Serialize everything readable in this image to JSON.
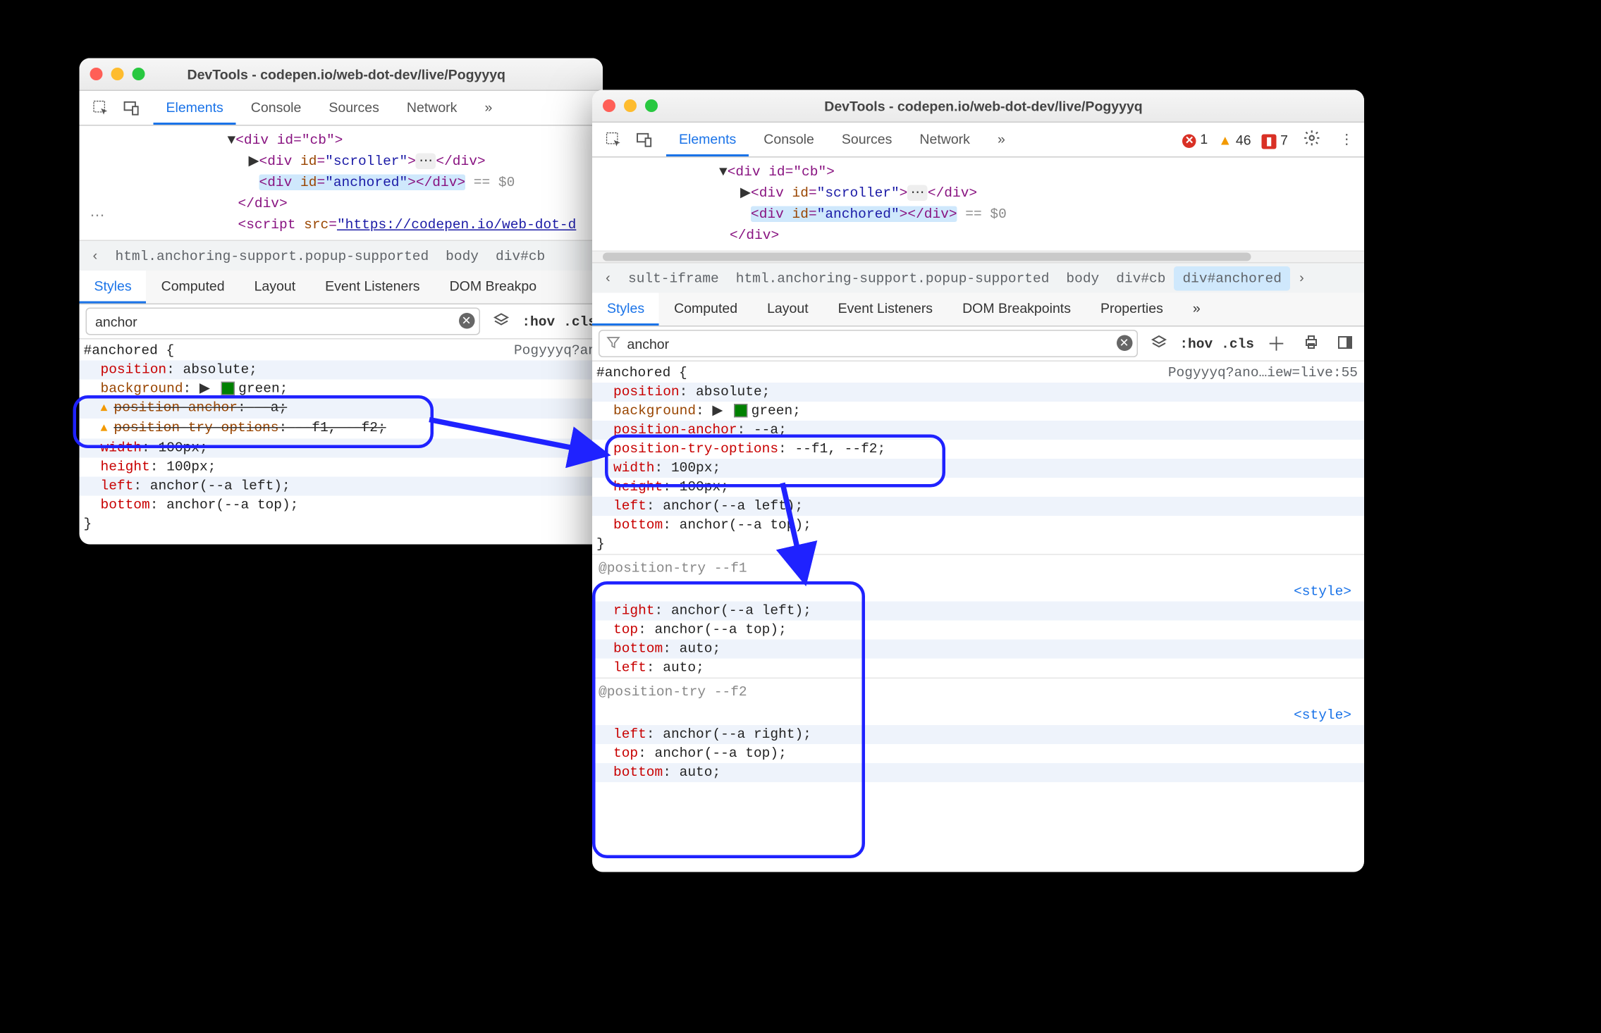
{
  "left": {
    "title": "DevTools - codepen.io/web-dot-dev/live/Pogyyyq",
    "tabs": [
      "Elements",
      "Console",
      "Sources",
      "Network"
    ],
    "activeTab": "Elements",
    "more": "»",
    "dom": {
      "l1": "<div id=\"cb\">",
      "l2_open": "<div id=\"scroller\">",
      "l2_close": "</div>",
      "l3": "<div id=\"anchored\"></div>",
      "eq": " == $0",
      "l4": "</div>",
      "script_open": "<script src=",
      "script_url": "\"https://codepen.io/web-dot-d"
    },
    "breadcrumbs": [
      "html.anchoring-support.popup-supported",
      "body",
      "div#cb"
    ],
    "subtabs": [
      "Styles",
      "Computed",
      "Layout",
      "Event Listeners",
      "DOM Breakpo"
    ],
    "activeSub": "Styles",
    "filter": "anchor",
    "hov": ":hov",
    "cls": ".cls",
    "cssLink": "Pogyyyq?an",
    "css": {
      "selector": "#anchored {",
      "p1": "position",
      "v1": "absolute",
      "p2": "background",
      "v2": "green",
      "p3": "position-anchor",
      "v3": "--a",
      "p4": "position-try-options",
      "v4": "--f1, --f2",
      "p5": "width",
      "v5": "100px",
      "p6": "height",
      "v6": "100px",
      "p7": "left",
      "v7": "anchor(--a left)",
      "p8": "bottom",
      "v8": "anchor(--a top)"
    }
  },
  "right": {
    "title": "DevTools - codepen.io/web-dot-dev/live/Pogyyyq",
    "tabs": [
      "Elements",
      "Console",
      "Sources",
      "Network"
    ],
    "activeTab": "Elements",
    "more": "»",
    "errors": "1",
    "warnings": "46",
    "blocked": "7",
    "dom": {
      "l1": "<div id=\"cb\">",
      "l2_open": "<div id=\"scroller\">",
      "l2_close": "</div>",
      "l3": "<div id=\"anchored\"></div>",
      "eq": " == $0",
      "l4": "</div>"
    },
    "breadcrumbs": [
      "sult-iframe",
      "html.anchoring-support.popup-supported",
      "body",
      "div#cb",
      "div#anchored"
    ],
    "subtabs": [
      "Styles",
      "Computed",
      "Layout",
      "Event Listeners",
      "DOM Breakpoints",
      "Properties"
    ],
    "activeSub": "Styles",
    "filter": "anchor",
    "hov": ":hov",
    "cls": ".cls",
    "cssLink": "Pogyyyq?ano…iew=live:55",
    "css": {
      "selector": "#anchored {",
      "p1": "position",
      "v1": "absolute",
      "p2": "background",
      "v2": "green",
      "p3": "position-anchor",
      "v3": "--a",
      "p4": "position-try-options",
      "v4": "--f1, --f2",
      "p5": "width",
      "v5": "100px",
      "p6": "height",
      "v6": "100px",
      "p7": "left",
      "v7": "anchor(--a left)",
      "p8": "bottom",
      "v8": "anchor(--a top)"
    },
    "try1": {
      "hdr": "@position-try --f1",
      "style": "<style>",
      "p1": "right",
      "v1": "anchor(--a left)",
      "p2": "top",
      "v2": "anchor(--a top)",
      "p3": "bottom",
      "v3": "auto",
      "p4": "left",
      "v4": "auto"
    },
    "try2": {
      "hdr": "@position-try --f2",
      "style": "<style>",
      "p1": "left",
      "v1": "anchor(--a right)",
      "p2": "top",
      "v2": "anchor(--a top)",
      "p3": "bottom",
      "v3": "auto"
    }
  }
}
